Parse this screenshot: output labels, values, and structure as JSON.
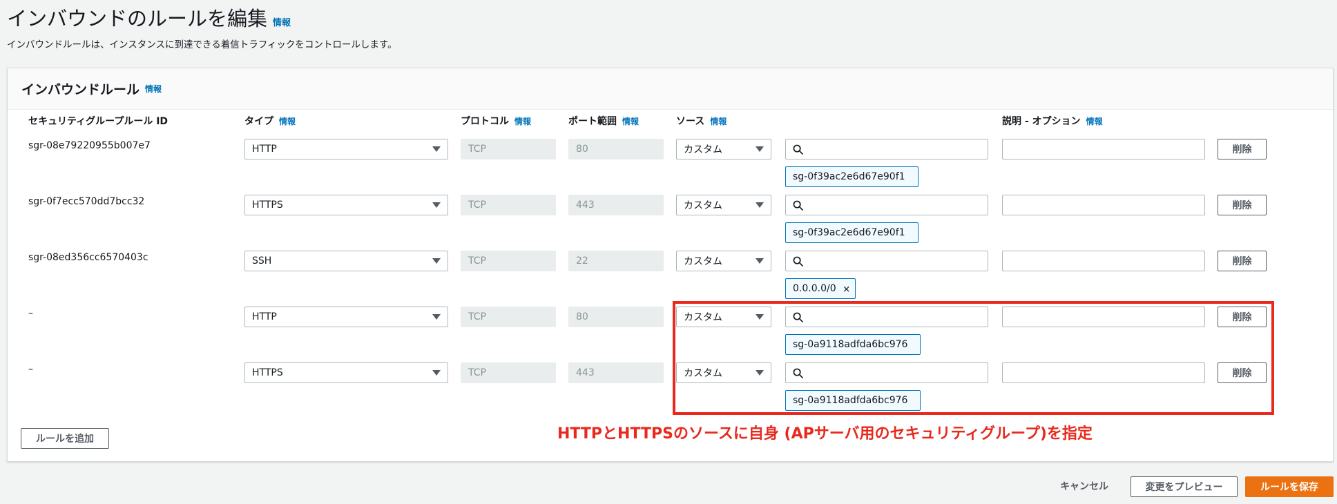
{
  "page": {
    "title": "インバウンドのルールを編集",
    "info": "情報",
    "description": "インバウンドルールは、インスタンスに到達できる着信トラフィックをコントロールします。"
  },
  "panel": {
    "title": "インバウンドルール",
    "info": "情報"
  },
  "columns": {
    "rule_id": "セキュリティグループルール ID",
    "type": "タイプ",
    "protocol": "プロトコル",
    "port_range": "ポート範囲",
    "source": "ソース",
    "description": "説明 - オプション",
    "info": "情報"
  },
  "rules": [
    {
      "id": "sgr-08e79220955b007e7",
      "type": "HTTP",
      "protocol": "TCP",
      "port": "80",
      "source_type": "カスタム",
      "source_token": "sg-0f39ac2e6d67e90f1",
      "delete": "削除"
    },
    {
      "id": "sgr-0f7ecc570dd7bcc32",
      "type": "HTTPS",
      "protocol": "TCP",
      "port": "443",
      "source_type": "カスタム",
      "source_token": "sg-0f39ac2e6d67e90f1",
      "delete": "削除"
    },
    {
      "id": "sgr-08ed356cc6570403c",
      "type": "SSH",
      "protocol": "TCP",
      "port": "22",
      "source_type": "カスタム",
      "source_token": "0.0.0.0/0",
      "delete": "削除"
    },
    {
      "id": "–",
      "type": "HTTP",
      "protocol": "TCP",
      "port": "80",
      "source_type": "カスタム",
      "source_token": "sg-0a9118adfda6bc976",
      "delete": "削除"
    },
    {
      "id": "–",
      "type": "HTTPS",
      "protocol": "TCP",
      "port": "443",
      "source_type": "カスタム",
      "source_token": "sg-0a9118adfda6bc976",
      "delete": "削除"
    }
  ],
  "add_rule_label": "ルールを追加",
  "annotation": "HTTPとHTTPSのソースに自身 (APサーバ用のセキュリティグループ)を指定",
  "footer": {
    "cancel": "キャンセル",
    "preview": "変更をプレビュー",
    "save": "ルールを保存"
  },
  "colors": {
    "accent": "#0073bb",
    "annotation_red": "#e8291c",
    "save_orange": "#ec7211"
  }
}
